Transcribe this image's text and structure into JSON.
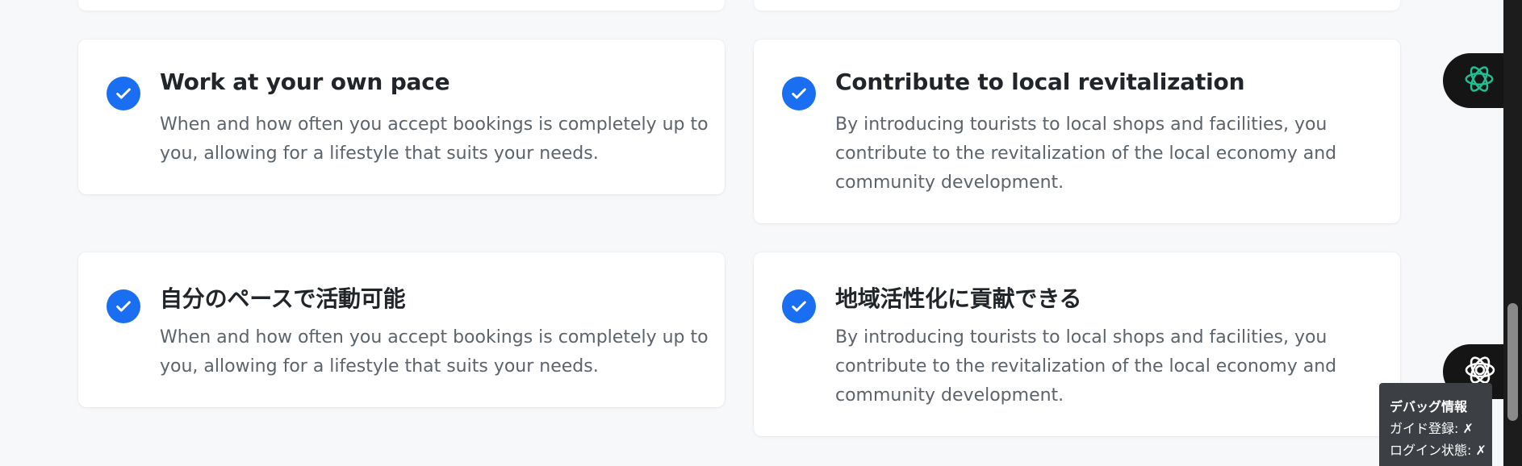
{
  "cards": [
    {
      "title": "Work at your own pace",
      "desc": "When and how often you accept bookings is completely up to you, allowing for a lifestyle that suits your needs."
    },
    {
      "title": "Contribute to local revitalization",
      "desc": "By introducing tourists to local shops and facilities, you contribute to the revitalization of the local economy and community development."
    },
    {
      "title": "自分のペースで活動可能",
      "desc": "When and how often you accept bookings is completely up to you, allowing for a lifestyle that suits your needs."
    },
    {
      "title": "地域活性化に貢献できる",
      "desc": "By introducing tourists to local shops and facilities, you contribute to the revitalization of the local economy and community development."
    }
  ],
  "debug": {
    "title": "デバッグ情報",
    "guide_registration": "ガイド登録: ✗",
    "login_status": "ログイン状態: ✗"
  },
  "colors": {
    "accent": "#1a6ef2",
    "ai_green": "#1fbf8f",
    "background": "#f7f8fa"
  },
  "icons": {
    "check": "check-circle-icon",
    "ai1": "chatgpt-logo-icon",
    "ai2": "ai-assistant-logo-icon"
  }
}
